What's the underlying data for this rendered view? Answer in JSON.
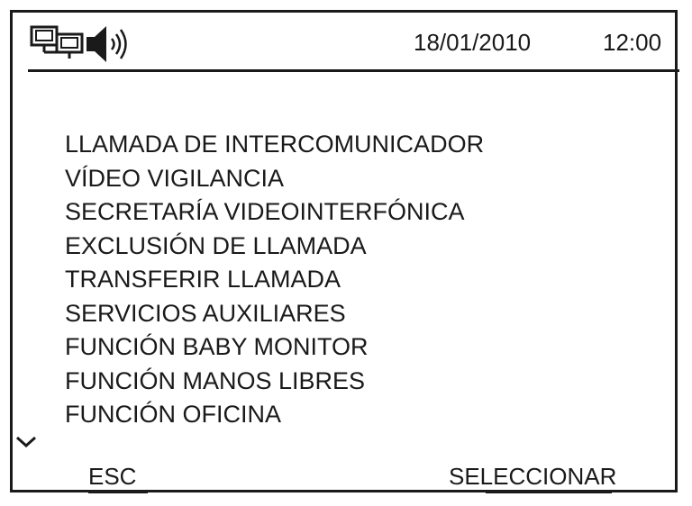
{
  "status_bar": {
    "icons": [
      "network-icon",
      "speaker-icon"
    ],
    "date": "18/01/2010",
    "time": "12:00"
  },
  "menu": {
    "items": [
      {
        "label": "LLAMADA DE INTERCOMUNICADOR"
      },
      {
        "label": "VÍDEO VIGILANCIA"
      },
      {
        "label": "SECRETARÍA VIDEOINTERFÓNICA"
      },
      {
        "label": "EXCLUSIÓN DE LLAMADA"
      },
      {
        "label": "TRANSFERIR LLAMADA"
      },
      {
        "label": "SERVICIOS AUXILIARES"
      },
      {
        "label": "FUNCIÓN BABY MONITOR"
      },
      {
        "label": "FUNCIÓN MANOS LIBRES"
      },
      {
        "label": "FUNCIÓN OFICINA"
      }
    ],
    "scroll_indicator_icon": "chevron-down-icon"
  },
  "softkeys": {
    "left_label": "ESC",
    "right_label": "SELECCIONAR"
  },
  "colors": {
    "foreground": "#1a1a1a",
    "background": "#ffffff"
  }
}
